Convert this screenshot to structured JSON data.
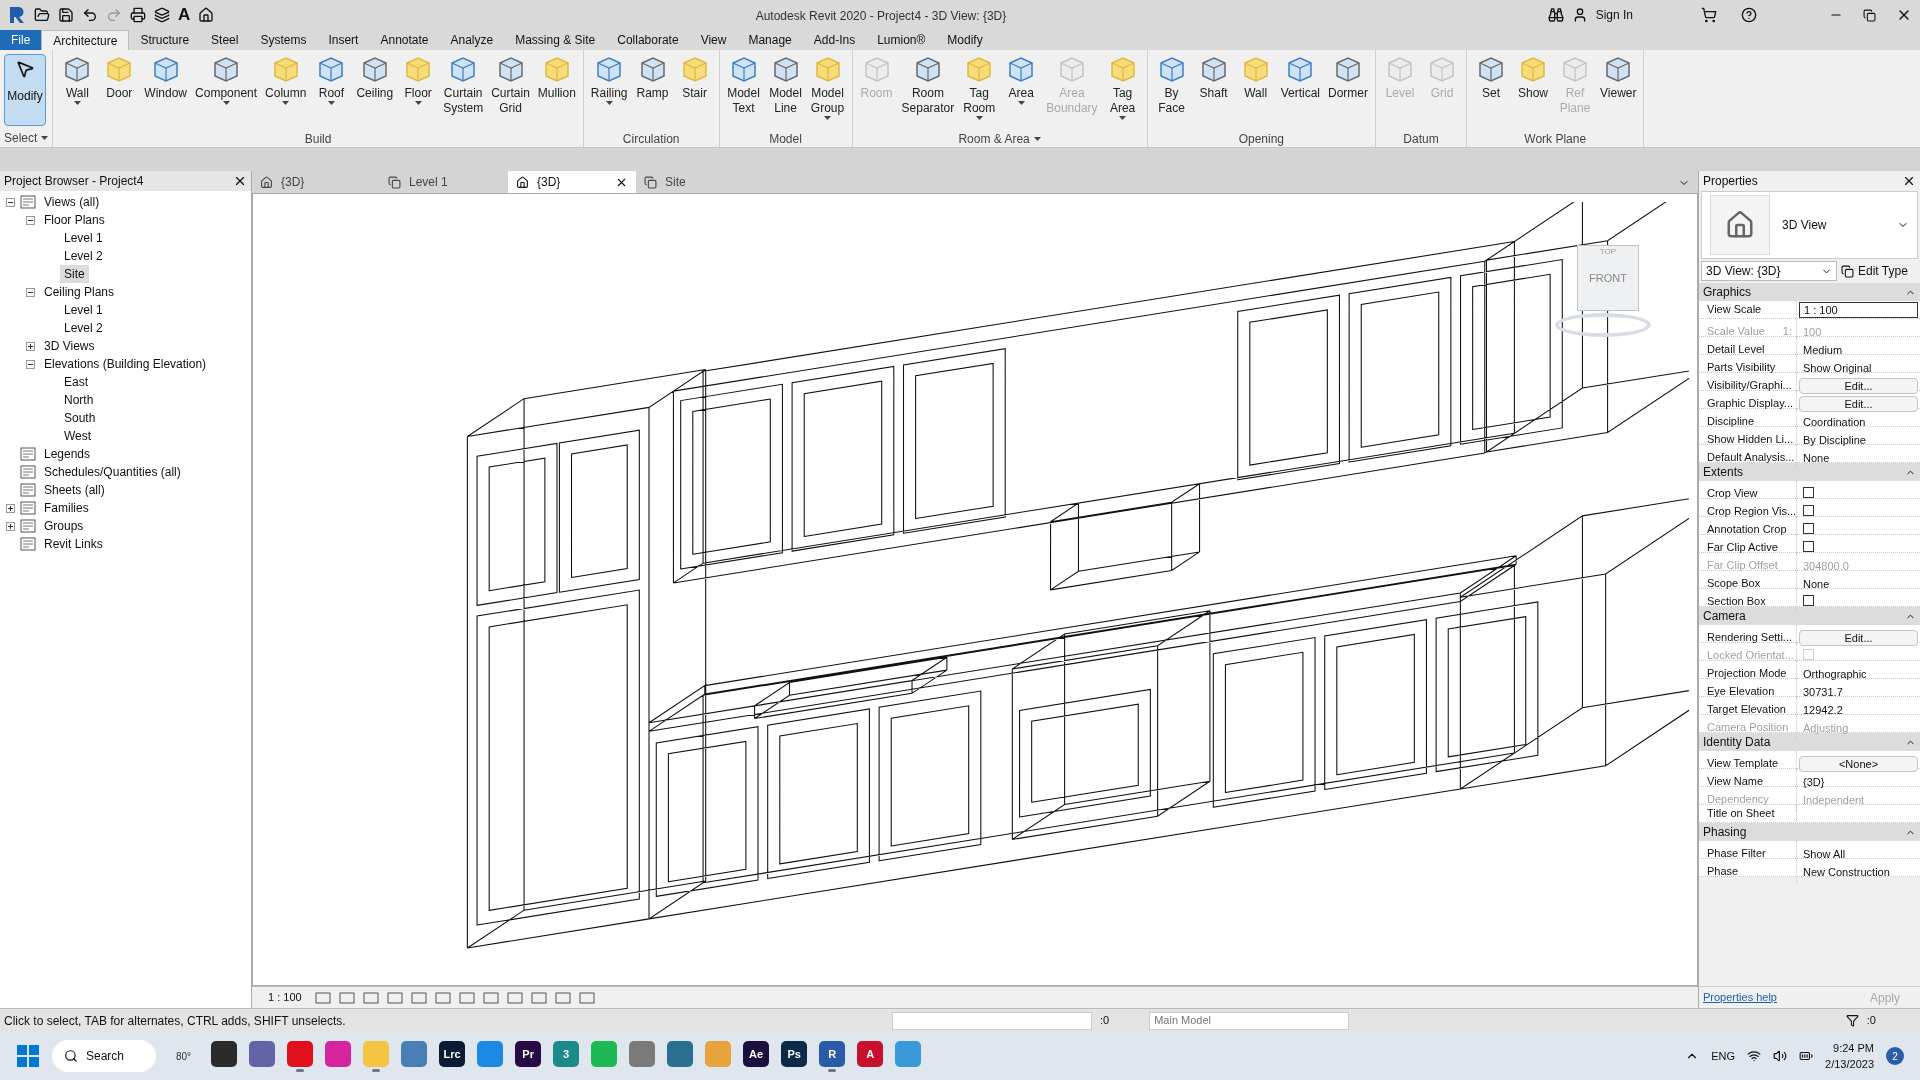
{
  "window": {
    "title": "Autodesk Revit 2020 - Project4 - 3D View: {3D}",
    "sign_in": "Sign In",
    "text_tool": "A"
  },
  "menu_tabs": [
    {
      "label": "File",
      "kind": "file",
      "selected": false
    },
    {
      "label": "Architecture",
      "kind": "tab",
      "selected": true
    },
    {
      "label": "Structure",
      "kind": "tab",
      "selected": false
    },
    {
      "label": "Steel",
      "kind": "tab",
      "selected": false
    },
    {
      "label": "Systems",
      "kind": "tab",
      "selected": false
    },
    {
      "label": "Insert",
      "kind": "tab",
      "selected": false
    },
    {
      "label": "Annotate",
      "kind": "tab",
      "selected": false
    },
    {
      "label": "Analyze",
      "kind": "tab",
      "selected": false
    },
    {
      "label": "Massing & Site",
      "kind": "tab",
      "selected": false
    },
    {
      "label": "Collaborate",
      "kind": "tab",
      "selected": false
    },
    {
      "label": "View",
      "kind": "tab",
      "selected": false
    },
    {
      "label": "Manage",
      "kind": "tab",
      "selected": false
    },
    {
      "label": "Add-Ins",
      "kind": "tab",
      "selected": false
    },
    {
      "label": "Lumion®",
      "kind": "tab",
      "selected": false
    },
    {
      "label": "Modify",
      "kind": "tab",
      "selected": false
    }
  ],
  "ribbon": [
    {
      "title": "Select",
      "kind": "select",
      "dropdown": true,
      "tools": [
        {
          "label": "Modify",
          "disabled": false,
          "dropdown": false
        }
      ]
    },
    {
      "title": "Build",
      "kind": "tools",
      "dropdown": false,
      "tools": [
        {
          "label": "Wall",
          "disabled": false,
          "dropdown": true
        },
        {
          "label": "Door",
          "disabled": false,
          "dropdown": false
        },
        {
          "label": "Window",
          "disabled": false,
          "dropdown": false
        },
        {
          "label": "Component",
          "disabled": false,
          "dropdown": true
        },
        {
          "label": "Column",
          "disabled": false,
          "dropdown": true
        },
        {
          "label": "Roof",
          "disabled": false,
          "dropdown": true
        },
        {
          "label": "Ceiling",
          "disabled": false,
          "dropdown": false
        },
        {
          "label": "Floor",
          "disabled": false,
          "dropdown": true
        },
        {
          "label": "Curtain\nSystem",
          "disabled": false,
          "dropdown": false
        },
        {
          "label": "Curtain\nGrid",
          "disabled": false,
          "dropdown": false
        },
        {
          "label": "Mullion",
          "disabled": false,
          "dropdown": false
        }
      ]
    },
    {
      "title": "Circulation",
      "kind": "tools",
      "dropdown": false,
      "tools": [
        {
          "label": "Railing",
          "disabled": false,
          "dropdown": true
        },
        {
          "label": "Ramp",
          "disabled": false,
          "dropdown": false
        },
        {
          "label": "Stair",
          "disabled": false,
          "dropdown": false
        }
      ]
    },
    {
      "title": "Model",
      "kind": "tools",
      "dropdown": false,
      "tools": [
        {
          "label": "Model\nText",
          "disabled": false,
          "dropdown": false
        },
        {
          "label": "Model\nLine",
          "disabled": false,
          "dropdown": false
        },
        {
          "label": "Model\nGroup",
          "disabled": false,
          "dropdown": true
        }
      ]
    },
    {
      "title": "Room & Area",
      "kind": "tools",
      "dropdown": true,
      "tools": [
        {
          "label": "Room",
          "disabled": true,
          "dropdown": false
        },
        {
          "label": "Room\nSeparator",
          "disabled": false,
          "dropdown": false
        },
        {
          "label": "Tag\nRoom",
          "disabled": false,
          "dropdown": true
        },
        {
          "label": "Area",
          "disabled": false,
          "dropdown": true
        },
        {
          "label": "Area\nBoundary",
          "disabled": true,
          "dropdown": false
        },
        {
          "label": "Tag\nArea",
          "disabled": false,
          "dropdown": true
        }
      ]
    },
    {
      "title": "Opening",
      "kind": "tools",
      "dropdown": false,
      "tools": [
        {
          "label": "By\nFace",
          "disabled": false,
          "dropdown": false
        },
        {
          "label": "Shaft",
          "disabled": false,
          "dropdown": false
        },
        {
          "label": "Wall",
          "disabled": false,
          "dropdown": false
        },
        {
          "label": "Vertical",
          "disabled": false,
          "dropdown": false
        },
        {
          "label": "Dormer",
          "disabled": false,
          "dropdown": false
        }
      ]
    },
    {
      "title": "Datum",
      "kind": "tools",
      "dropdown": false,
      "tools": [
        {
          "label": "Level",
          "disabled": true,
          "dropdown": false
        },
        {
          "label": "Grid",
          "disabled": true,
          "dropdown": false
        }
      ]
    },
    {
      "title": "Work Plane",
      "kind": "tools",
      "dropdown": false,
      "tools": [
        {
          "label": "Set",
          "disabled": false,
          "dropdown": false
        },
        {
          "label": "Show",
          "disabled": false,
          "dropdown": false
        },
        {
          "label": "Ref\nPlane",
          "disabled": true,
          "dropdown": false
        },
        {
          "label": "Viewer",
          "disabled": false,
          "dropdown": false
        }
      ]
    }
  ],
  "project_browser": {
    "title": "Project Browser - Project4",
    "tree": [
      {
        "label": "Views (all)",
        "expanded": true,
        "selected": false,
        "children": [
          {
            "label": "Floor Plans",
            "expanded": true,
            "selected": false,
            "children": [
              {
                "label": "Level 1",
                "selected": false
              },
              {
                "label": "Level 2",
                "selected": false
              },
              {
                "label": "Site",
                "selected": true
              }
            ]
          },
          {
            "label": "Ceiling Plans",
            "expanded": true,
            "selected": false,
            "children": [
              {
                "label": "Level 1",
                "selected": false
              },
              {
                "label": "Level 2",
                "selected": false
              }
            ]
          },
          {
            "label": "3D Views",
            "expanded": false,
            "selected": false
          },
          {
            "label": "Elevations (Building Elevation)",
            "expanded": true,
            "selected": false,
            "children": [
              {
                "label": "East",
                "selected": false
              },
              {
                "label": "North",
                "selected": false
              },
              {
                "label": "South",
                "selected": false
              },
              {
                "label": "West",
                "selected": false
              }
            ]
          }
        ]
      },
      {
        "label": "Legends",
        "selected": false
      },
      {
        "label": "Schedules/Quantities (all)",
        "selected": false
      },
      {
        "label": "Sheets (all)",
        "selected": false
      },
      {
        "label": "Families",
        "expanded": false,
        "selected": false
      },
      {
        "label": "Groups",
        "expanded": false,
        "selected": false
      },
      {
        "label": "Revit Links",
        "selected": false
      }
    ]
  },
  "view_tabs": [
    {
      "label": "{3D}",
      "kind": "threed",
      "selected": false
    },
    {
      "label": "Level 1",
      "kind": "plan",
      "selected": false
    },
    {
      "label": "{3D}",
      "kind": "threed",
      "selected": true
    },
    {
      "label": "Site",
      "kind": "plan",
      "selected": false
    }
  ],
  "view_cube": {
    "top": "TOP",
    "front": "FRONT"
  },
  "view_bar": {
    "scale": "1 : 100"
  },
  "properties": {
    "title": "Properties",
    "type_name": "3D View",
    "selector": "3D View: {3D}",
    "edit_type": "Edit Type",
    "sections": [
      {
        "title": "Graphics",
        "rows": [
          {
            "label": "View Scale",
            "value": "1 : 100",
            "kind": "input",
            "disabled": false
          },
          {
            "label": "Scale Value",
            "unit": "1:",
            "value": "100",
            "kind": "text",
            "disabled": true
          },
          {
            "label": "Detail Level",
            "value": "Medium",
            "kind": "text",
            "disabled": false
          },
          {
            "label": "Parts Visibility",
            "value": "Show Original",
            "kind": "text",
            "disabled": false
          },
          {
            "label": "Visibility/Graphi...",
            "value": "Edit...",
            "kind": "button",
            "disabled": false
          },
          {
            "label": "Graphic Display...",
            "value": "Edit...",
            "kind": "button",
            "disabled": false
          },
          {
            "label": "Discipline",
            "value": "Coordination",
            "kind": "text",
            "disabled": false
          },
          {
            "label": "Show Hidden Li...",
            "value": "By Discipline",
            "kind": "text",
            "disabled": false
          },
          {
            "label": "Default Analysis...",
            "value": "None",
            "kind": "text",
            "disabled": false
          }
        ]
      },
      {
        "title": "Extents",
        "rows": [
          {
            "label": "Crop View",
            "kind": "checkbox",
            "checked": false,
            "disabled": false
          },
          {
            "label": "Crop Region Vis...",
            "kind": "checkbox",
            "checked": false,
            "disabled": false
          },
          {
            "label": "Annotation Crop",
            "kind": "checkbox",
            "checked": false,
            "disabled": false
          },
          {
            "label": "Far Clip Active",
            "kind": "checkbox",
            "checked": false,
            "disabled": false
          },
          {
            "label": "Far Clip Offset",
            "value": "304800.0",
            "kind": "text",
            "disabled": true
          },
          {
            "label": "Scope Box",
            "value": "None",
            "kind": "text",
            "disabled": false
          },
          {
            "label": "Section Box",
            "kind": "checkbox",
            "checked": false,
            "disabled": false
          }
        ]
      },
      {
        "title": "Camera",
        "rows": [
          {
            "label": "Rendering Setti...",
            "value": "Edit...",
            "kind": "button",
            "disabled": false
          },
          {
            "label": "Locked Orientat...",
            "kind": "checkbox",
            "checked": false,
            "disabled": true
          },
          {
            "label": "Projection Mode",
            "value": "Orthographic",
            "kind": "text",
            "disabled": false
          },
          {
            "label": "Eye Elevation",
            "value": "30731.7",
            "kind": "text",
            "disabled": false
          },
          {
            "label": "Target Elevation",
            "value": "12942.2",
            "kind": "text",
            "disabled": false
          },
          {
            "label": "Camera Position",
            "value": "Adjusting",
            "kind": "text",
            "disabled": true
          }
        ]
      },
      {
        "title": "Identity Data",
        "rows": [
          {
            "label": "View Template",
            "value": "<None>",
            "kind": "button",
            "disabled": false
          },
          {
            "label": "View Name",
            "value": "{3D}",
            "kind": "text",
            "disabled": false
          },
          {
            "label": "Dependency",
            "value": "Independent",
            "kind": "text",
            "disabled": true
          },
          {
            "label": "Title on Sheet",
            "kind": "text",
            "disabled": false
          }
        ]
      },
      {
        "title": "Phasing",
        "rows": [
          {
            "label": "Phase Filter",
            "value": "Show All",
            "kind": "text",
            "disabled": false
          },
          {
            "label": "Phase",
            "value": "New Construction",
            "kind": "text",
            "disabled": false
          }
        ]
      }
    ],
    "help": "Properties help",
    "apply": {
      "label": "Apply",
      "disabled": true
    }
  },
  "status_bar": {
    "message": "Click to select, TAB for alternates, CTRL adds, SHIFT unselects.",
    "workset_count": ":0",
    "model": "Main Model",
    "filter_count": ":0"
  },
  "taskbar": {
    "search": "Search",
    "weather": "80°",
    "apps": [
      {
        "color": "#2b2b2b",
        "running": false
      },
      {
        "color": "#6264a7",
        "running": false
      },
      {
        "color": "#e0101e",
        "running": true
      },
      {
        "color": "#d6249f",
        "running": false
      },
      {
        "color": "#f4c542",
        "running": true
      },
      {
        "color": "#4a7fb5",
        "running": false
      },
      {
        "label": "Lrc",
        "color": "#0b1b33",
        "running": false
      },
      {
        "color": "#1e88e5",
        "running": false
      },
      {
        "label": "Pr",
        "color": "#2a0a45",
        "running": false
      },
      {
        "label": "3",
        "color": "#1a8a8a",
        "running": false
      },
      {
        "color": "#1db954",
        "running": false
      },
      {
        "color": "#7a7a7a",
        "running": false
      },
      {
        "color": "#2a6f8f",
        "running": false
      },
      {
        "color": "#e8a33c",
        "running": false
      },
      {
        "label": "Ae",
        "color": "#1a0f3d",
        "running": false
      },
      {
        "label": "Ps",
        "color": "#0b2a4a",
        "running": false
      },
      {
        "label": "R",
        "color": "#2a5ba8",
        "running": true
      },
      {
        "label": "A",
        "color": "#c8102e",
        "running": false
      },
      {
        "color": "#3a9ad9",
        "running": false
      }
    ],
    "language": "ENG",
    "time": "9:24 PM",
    "date": "2/13/2023",
    "notifications": "2"
  }
}
